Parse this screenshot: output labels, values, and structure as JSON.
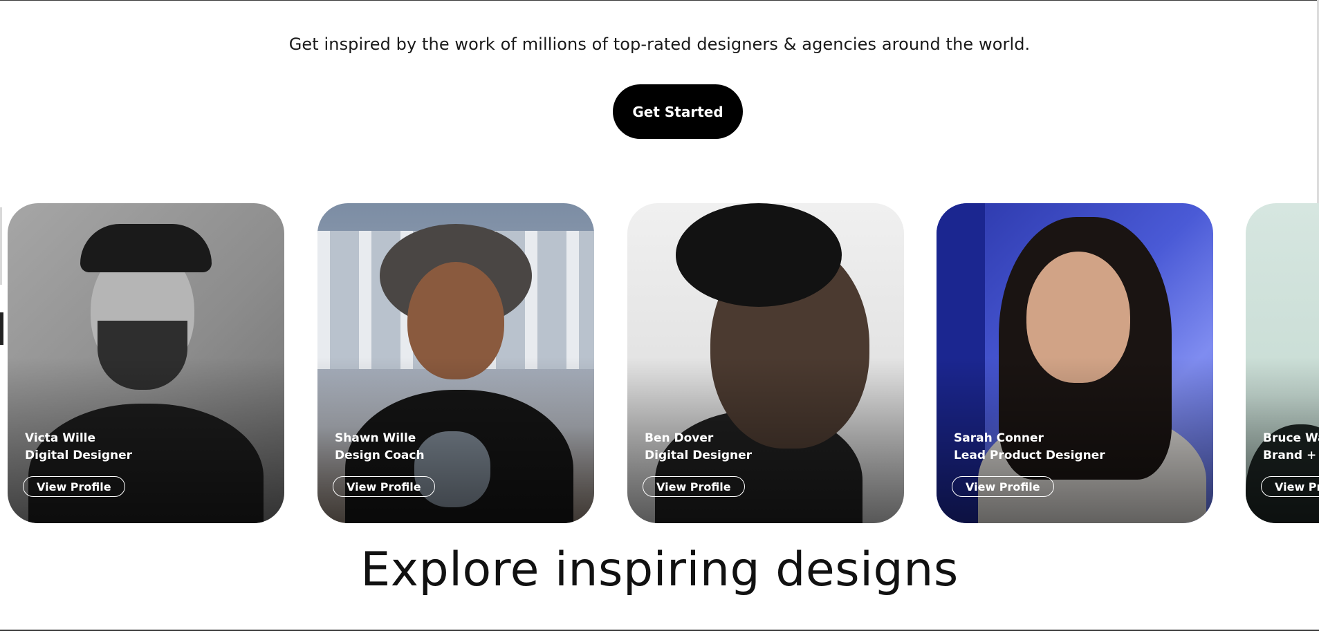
{
  "hero": {
    "subheadline": "Get inspired by the work of millions of top-rated designers & agencies around the world.",
    "cta_label": "Get Started"
  },
  "designers": [
    {
      "name": "Victa Wille",
      "role": "Digital Designer",
      "button": "View Profile"
    },
    {
      "name": "Shawn Wille",
      "role": "Design Coach",
      "button": "View Profile"
    },
    {
      "name": "Ben Dover",
      "role": "Digital Designer",
      "button": "View Profile"
    },
    {
      "name": "Sarah Conner",
      "role": "Lead Product Designer",
      "button": "View Profile"
    },
    {
      "name": "Bruce Wa",
      "role": "Brand + Il",
      "button": "View Pr"
    }
  ],
  "section": {
    "title": "Explore inspiring designs"
  },
  "colors": {
    "cta_bg": "#000000",
    "text": "#111111",
    "card_text": "#ffffff"
  }
}
